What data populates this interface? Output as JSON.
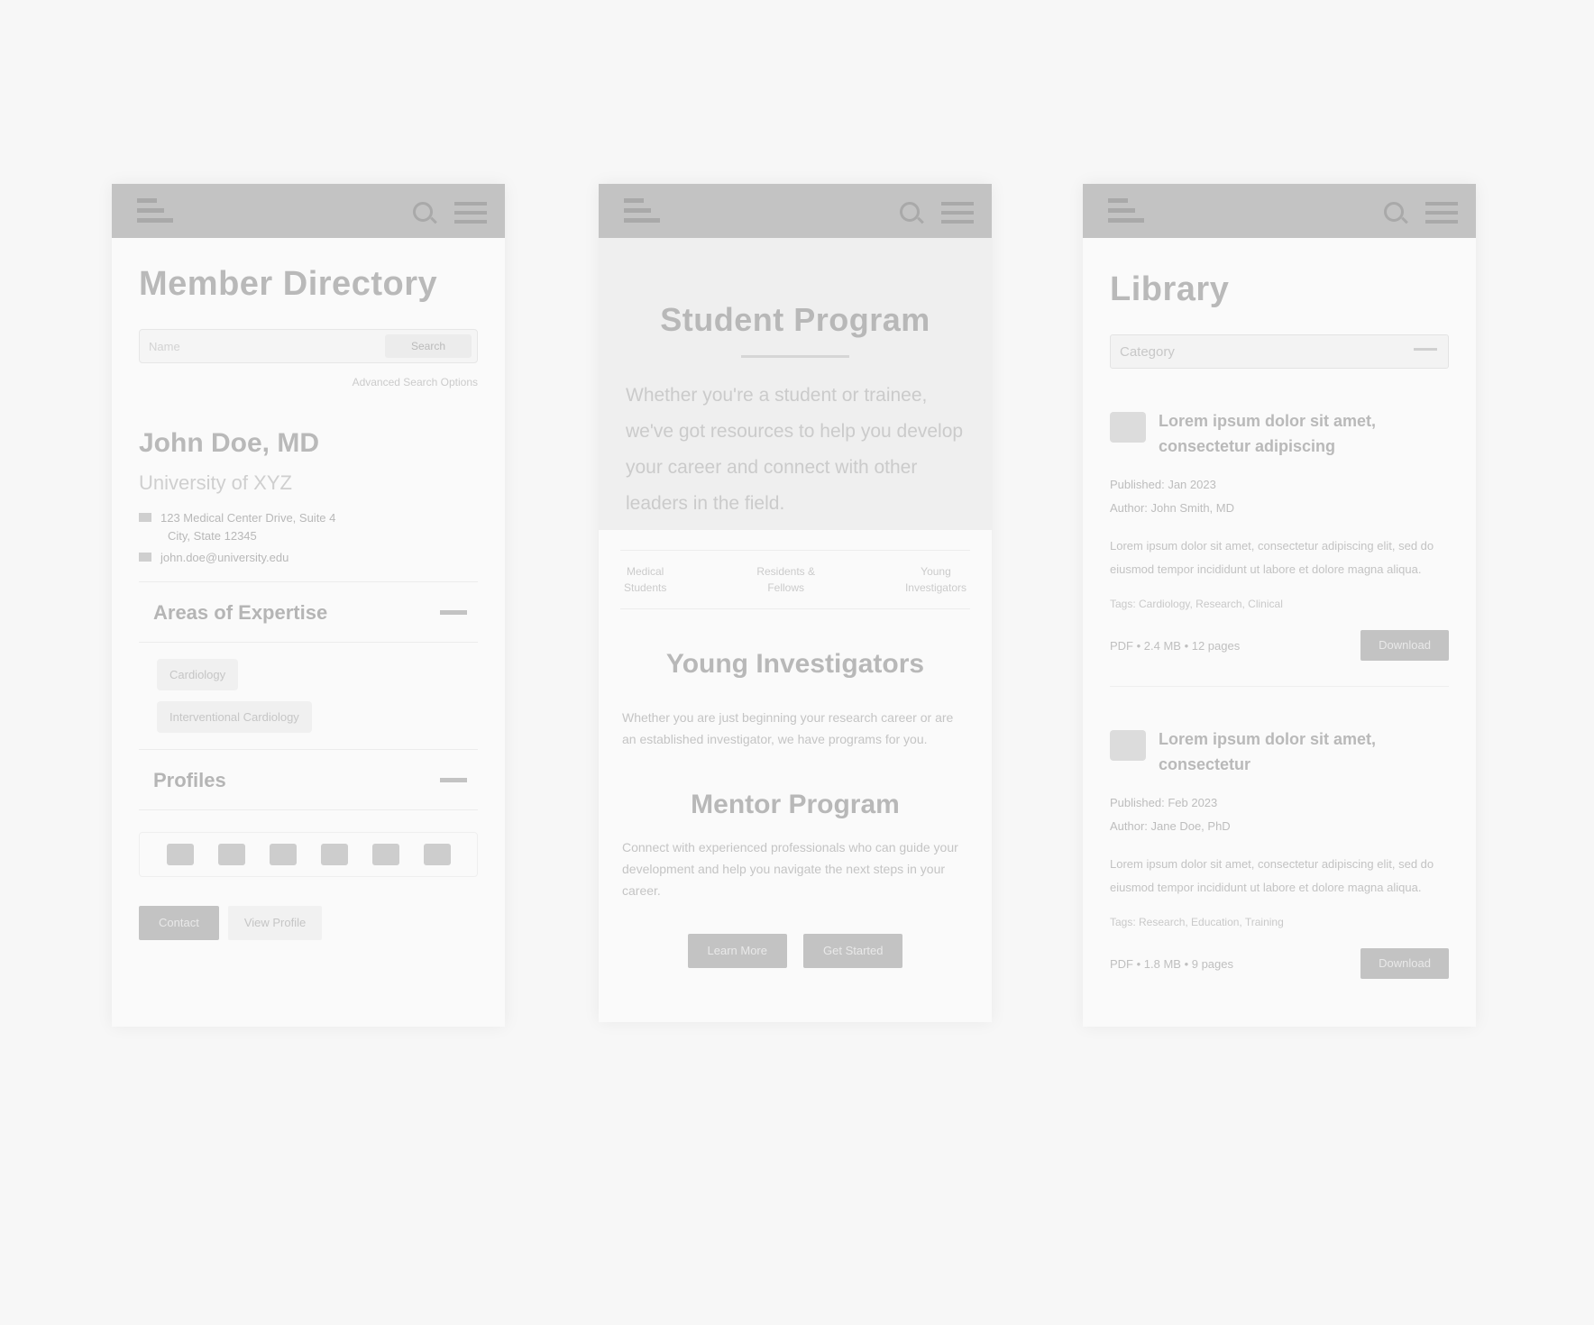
{
  "screen1": {
    "title": "Member Directory",
    "search": {
      "placeholder": "Name",
      "button": "Search"
    },
    "advanced_link": "Advanced Search Options",
    "member": {
      "name": "John Doe, MD",
      "org": "University of XYZ",
      "address_line1": "123 Medical Center Drive, Suite 4",
      "address_line2": "City, State 12345",
      "email": "john.doe@university.edu"
    },
    "accordion1": "Areas of Expertise",
    "expertise": [
      "Cardiology",
      "Interventional Cardiology"
    ],
    "accordion2": "Profiles",
    "buttons": {
      "primary": "Contact",
      "secondary": "View Profile"
    }
  },
  "screen2": {
    "hero_title": "Student Program",
    "hero_text": "Whether you're a student or trainee, we've got resources to help you develop your career and connect with other leaders in the field.",
    "tabs": [
      {
        "line1": "Medical",
        "line2": "Students"
      },
      {
        "line1": "Residents &",
        "line2": "Fellows"
      },
      {
        "line1": "Young",
        "line2": "Investigators"
      }
    ],
    "section1_title": "Young Investigators",
    "section1_text": "Whether you are just beginning your research career or are an established investigator, we have programs for you.",
    "section2_title": "Mentor Program",
    "section2_text": "Connect with experienced professionals who can guide your development and help you navigate the next steps in your career.",
    "buttons": {
      "primary": "Learn More",
      "secondary": "Get Started"
    }
  },
  "screen3": {
    "title": "Library",
    "select_value": "Category",
    "items": [
      {
        "title": "Lorem ipsum dolor sit amet, consectetur adipiscing",
        "date": "Published: Jan 2023",
        "author": "Author: John Smith, MD",
        "desc": "Lorem ipsum dolor sit amet, consectetur adipiscing elit, sed do eiusmod tempor incididunt ut labore et dolore magna aliqua.",
        "tags": "Tags: Cardiology, Research, Clinical",
        "info": "PDF • 2.4 MB • 12 pages",
        "button": "Download"
      },
      {
        "title": "Lorem ipsum dolor sit amet, consectetur",
        "date": "Published: Feb 2023",
        "author": "Author: Jane Doe, PhD",
        "desc": "Lorem ipsum dolor sit amet, consectetur adipiscing elit, sed do eiusmod tempor incididunt ut labore et dolore magna aliqua.",
        "tags": "Tags: Research, Education, Training",
        "info": "PDF • 1.8 MB • 9 pages",
        "button": "Download"
      }
    ]
  }
}
